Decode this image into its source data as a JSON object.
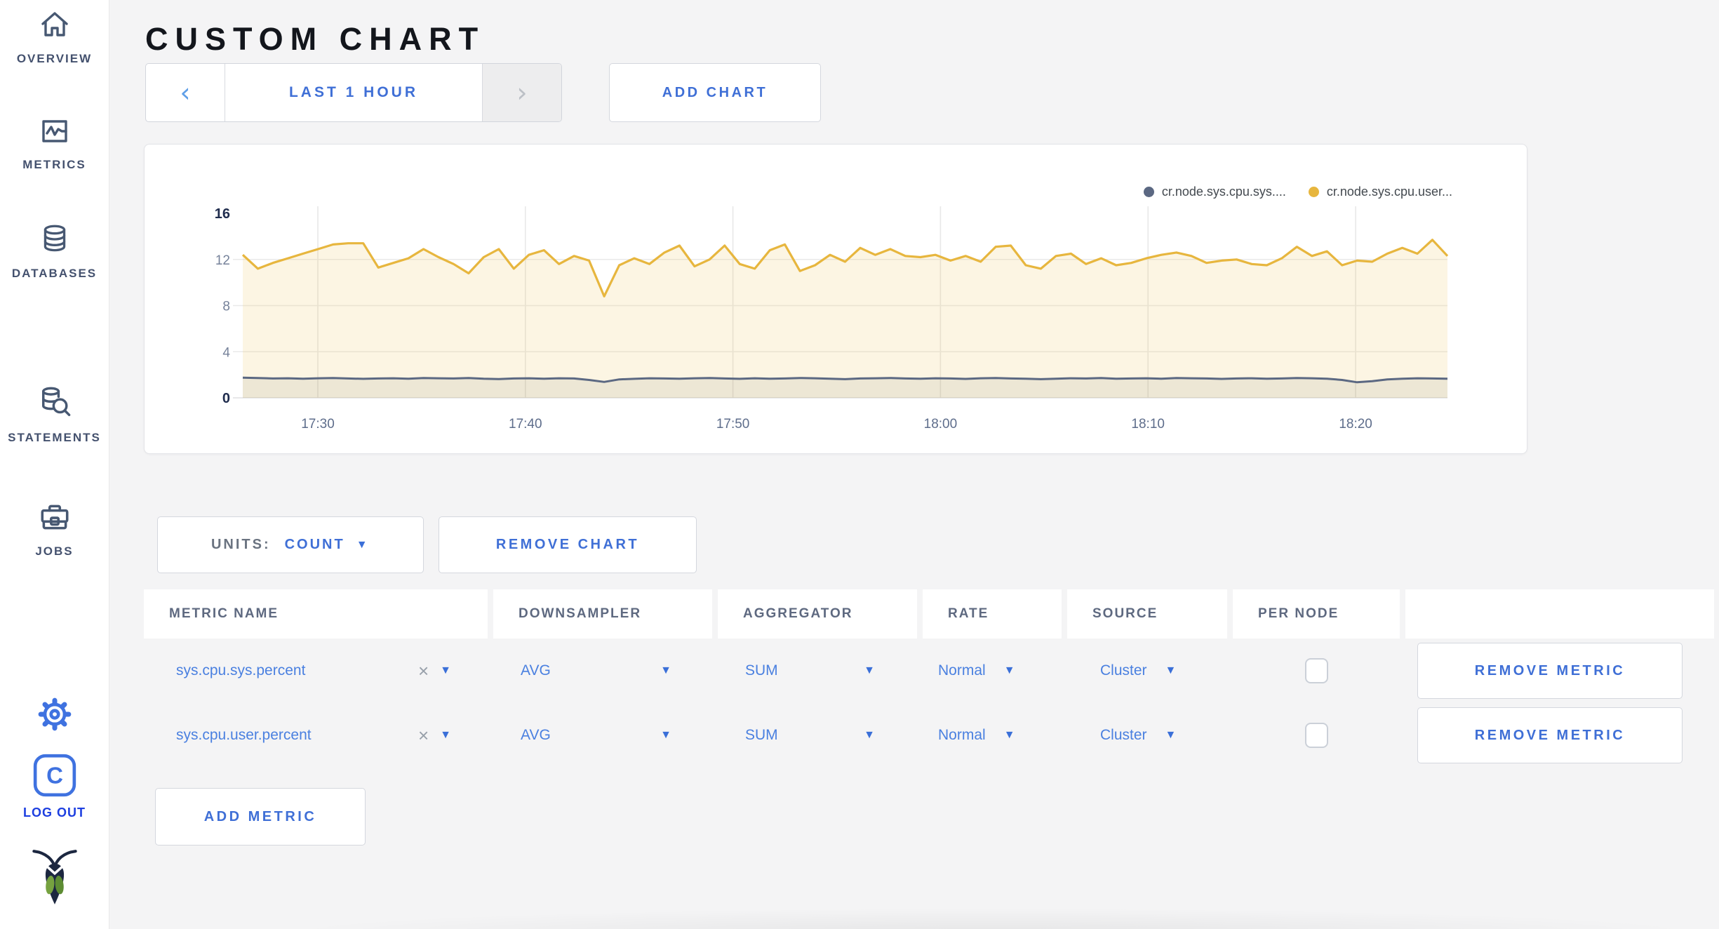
{
  "sidebar": {
    "items": [
      {
        "label": "OVERVIEW",
        "icon": "home-icon"
      },
      {
        "label": "METRICS",
        "icon": "metrics-icon"
      },
      {
        "label": "DATABASES",
        "icon": "databases-icon"
      },
      {
        "label": "STATEMENTS",
        "icon": "statements-icon"
      },
      {
        "label": "JOBS",
        "icon": "jobs-icon"
      }
    ],
    "logout_label": "LOG OUT"
  },
  "header": {
    "title": "CUSTOM CHART"
  },
  "controls": {
    "prev_arrow": "‹",
    "time_range": "LAST 1 HOUR",
    "next_arrow": "›",
    "add_chart": "ADD CHART"
  },
  "units": {
    "label": "UNITS:",
    "value": "COUNT"
  },
  "buttons": {
    "remove_chart": "REMOVE CHART",
    "add_metric": "ADD METRIC"
  },
  "table": {
    "columns": [
      "METRIC NAME",
      "DOWNSAMPLER",
      "AGGREGATOR",
      "RATE",
      "SOURCE",
      "PER NODE",
      ""
    ],
    "rows": [
      {
        "name": "sys.cpu.sys.percent",
        "clear": "×",
        "downsampler": "AVG",
        "aggregator": "SUM",
        "rate": "Normal",
        "source": "Cluster",
        "per_node": false,
        "remove_label": "REMOVE METRIC"
      },
      {
        "name": "sys.cpu.user.percent",
        "clear": "×",
        "downsampler": "AVG",
        "aggregator": "SUM",
        "rate": "Normal",
        "source": "Cluster",
        "per_node": false,
        "remove_label": "REMOVE METRIC"
      }
    ]
  },
  "chart_data": {
    "type": "line",
    "title": "",
    "xlabel": "",
    "ylabel": "",
    "ylim": [
      0,
      16
    ],
    "yticks": [
      0,
      4,
      8,
      12,
      16
    ],
    "x_ticks": [
      "17:30",
      "17:40",
      "17:50",
      "18:00",
      "18:10",
      "18:20"
    ],
    "grid": true,
    "legend_position": "top-right",
    "series": [
      {
        "name": "cr.node.sys.cpu.sys....",
        "color": "#5b6882",
        "fill": "rgba(105,108,98,0.10)",
        "values": [
          1.75,
          1.72,
          1.68,
          1.7,
          1.66,
          1.7,
          1.72,
          1.68,
          1.65,
          1.68,
          1.7,
          1.66,
          1.72,
          1.7,
          1.68,
          1.72,
          1.66,
          1.63,
          1.68,
          1.7,
          1.66,
          1.7,
          1.68,
          1.55,
          1.38,
          1.6,
          1.65,
          1.7,
          1.68,
          1.66,
          1.7,
          1.72,
          1.68,
          1.65,
          1.7,
          1.66,
          1.68,
          1.72,
          1.7,
          1.66,
          1.62,
          1.68,
          1.7,
          1.72,
          1.68,
          1.66,
          1.7,
          1.68,
          1.64,
          1.7,
          1.72,
          1.68,
          1.66,
          1.62,
          1.66,
          1.7,
          1.68,
          1.72,
          1.66,
          1.68,
          1.7,
          1.66,
          1.72,
          1.7,
          1.68,
          1.64,
          1.68,
          1.7,
          1.66,
          1.68,
          1.72,
          1.7,
          1.66,
          1.55,
          1.35,
          1.45,
          1.6,
          1.66,
          1.7,
          1.68,
          1.66
        ]
      },
      {
        "name": "cr.node.sys.cpu.user...",
        "color": "#e7b63e",
        "fill": "rgba(233,186,68,0.15)",
        "values": [
          12.4,
          11.2,
          11.7,
          12.1,
          12.5,
          12.9,
          13.3,
          13.4,
          13.4,
          11.3,
          11.7,
          12.1,
          12.9,
          12.2,
          11.6,
          10.8,
          12.2,
          12.9,
          11.2,
          12.4,
          12.8,
          11.6,
          12.3,
          11.9,
          8.8,
          11.5,
          12.1,
          11.6,
          12.6,
          13.2,
          11.4,
          12.0,
          13.2,
          11.6,
          11.2,
          12.8,
          13.3,
          11.0,
          11.5,
          12.4,
          11.8,
          13.0,
          12.4,
          12.9,
          12.3,
          12.2,
          12.4,
          11.9,
          12.3,
          11.8,
          13.1,
          13.2,
          11.5,
          11.2,
          12.3,
          12.5,
          11.6,
          12.1,
          11.5,
          11.7,
          12.1,
          12.4,
          12.6,
          12.3,
          11.7,
          11.9,
          12.0,
          11.6,
          11.5,
          12.1,
          13.1,
          12.3,
          12.7,
          11.5,
          11.9,
          11.8,
          12.5,
          13.0,
          12.5,
          13.7,
          12.3
        ]
      }
    ]
  }
}
